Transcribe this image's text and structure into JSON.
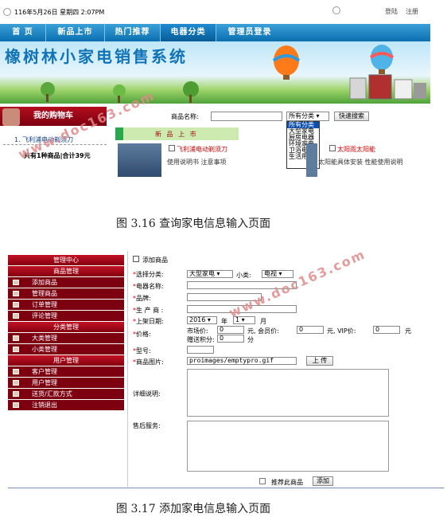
{
  "fig1": {
    "topbar": {
      "date": "116年5月26日  星期四  2:07PM",
      "login": "登陆",
      "register": "注册"
    },
    "nav": [
      "首 页",
      "新品上市",
      "热门推荐",
      "电器分类",
      "管理员登录"
    ],
    "banner_title": "橡树林小家电销售系统",
    "cart": {
      "title": "我的购物车",
      "item": "1. 飞利浦电动剃须刀",
      "summary": "共有1种商品|合计39元"
    },
    "search": {
      "label": "商品名称:",
      "selected": "所有分类",
      "button": "快速搜索"
    },
    "dropdown_options": [
      "所有分类",
      "大型家电",
      "厨房电器",
      "环境家电",
      "卫浴电器",
      "生活用品"
    ],
    "new_label": "新 品 上 市",
    "products": [
      {
        "name": "飞利浦电动剃须刀",
        "links": "使用说明书  注意事项"
      },
      {
        "name": "太阳雨太阳能",
        "links": "太阳能具体安装  性能使用说明"
      }
    ],
    "caption": "图 3.16 查询家电信息输入页面",
    "watermark": "www.doc163.com"
  },
  "fig2": {
    "menu": [
      {
        "label": "管理中心",
        "head": true
      },
      {
        "label": "商品管理",
        "head": true
      },
      {
        "label": "添加商品",
        "head": false
      },
      {
        "label": "管理商品",
        "head": false
      },
      {
        "label": "订单管理",
        "head": false
      },
      {
        "label": "评论管理",
        "head": false
      },
      {
        "label": "分类管理",
        "head": true
      },
      {
        "label": "大类管理",
        "head": false
      },
      {
        "label": "小类管理",
        "head": false
      },
      {
        "label": "用户管理",
        "head": true
      },
      {
        "label": "客户管理",
        "head": false
      },
      {
        "label": "用户管理",
        "head": false
      },
      {
        "label": "送货/汇款方式",
        "head": false
      },
      {
        "label": "注销退出",
        "head": false
      }
    ],
    "form_title": "添加商品",
    "category_label": "选择分类:",
    "category_value": "大型家电",
    "subcat_label": "小类:",
    "subcat_value": "电视",
    "name_label": "电器名称:",
    "brand_label": "品牌:",
    "maker_label": "生 产 商 :",
    "date_label": "上架日期:",
    "year": "2016",
    "year_unit": "年",
    "month": "1",
    "month_unit": "月",
    "price_label": "价格:",
    "market_price": "市场价:",
    "market_val": "0",
    "member_price": "元,  会员价:",
    "member_val": "0",
    "vip_price": "元,  VIP价:",
    "vip_val": "0",
    "yuan": "元",
    "points_label": "赠送积分:",
    "points_val": "0",
    "points_unit": "分",
    "model_label": "型号:",
    "image_label": "商品图片:",
    "image_value": "proimages/emptypro.gif",
    "upload": "上 传",
    "detail_label": "详细说明:",
    "after_label": "售后服务:",
    "recommend": "推荐此商品",
    "add_button": "添加"
  },
  "caption2": "图 3.17 添加家电信息输入页面",
  "watermark2": "www.doc163.com"
}
